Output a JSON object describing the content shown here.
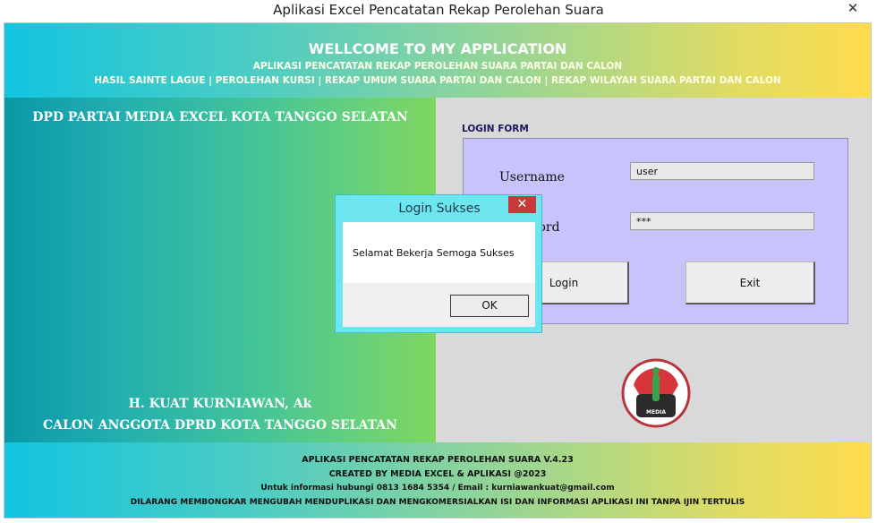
{
  "window": {
    "title": "Aplikasi Excel Pencatatan Rekap Perolehan Suara",
    "close_glyph": "✕"
  },
  "header": {
    "title": "WELLCOME TO MY APPLICATION",
    "subtitle": "APLIKASI PENCATATAN REKAP PEROLEHAN SUARA PARTAI DAN CALON",
    "menu_line": "HASIL SAINTE LAGUE | PEROLEHAN KURSI | REKAP UMUM SUARA PARTAI DAN CALON | REKAP WILAYAH SUARA PARTAI DAN CALON"
  },
  "left_panel": {
    "org_name": "DPD PARTAI MEDIA EXCEL KOTA TANGGO SELATAN",
    "candidate_name": "H. KUAT KURNIAWAN, Ak",
    "candidate_title": "CALON ANGGOTA DPRD KOTA TANGGO SELATAN"
  },
  "login": {
    "form_label": "LOGIN FORM",
    "username_label": "Username",
    "username_value": "user",
    "password_label": "Password",
    "password_value": "***",
    "login_button": "Login",
    "exit_button": "Exit"
  },
  "logo": {
    "icon": "media-excel-logo",
    "text": "MEDIA"
  },
  "footer": {
    "line1": "APLIKASI PENCATATAN REKAP PEROLEHAN SUARA V.4.23",
    "line2": "CREATED BY MEDIA EXCEL & APLIKASI @2023",
    "line3": "Untuk informasi hubungi 0813 1684 5354 / Email : kurniawankuat@gmail.com",
    "line4": "DILARANG MEMBONGKAR MENGUBAH MENDUPLIKASI DAN MENGKOMERSIALKAN ISI DAN INFORMASI APLIKASI INI TANPA IJIN TERTULIS"
  },
  "dialog": {
    "title": "Login Sukses",
    "close_glyph": "✕",
    "message": "Selamat Bekerja Semoga Sukses",
    "ok_button": "OK"
  },
  "colors": {
    "dialog_title_bg": "#6ee6f0",
    "close_red": "#c83a3a",
    "login_box_bg": "#c8c3fb",
    "right_panel_bg": "#d9d9d9"
  }
}
